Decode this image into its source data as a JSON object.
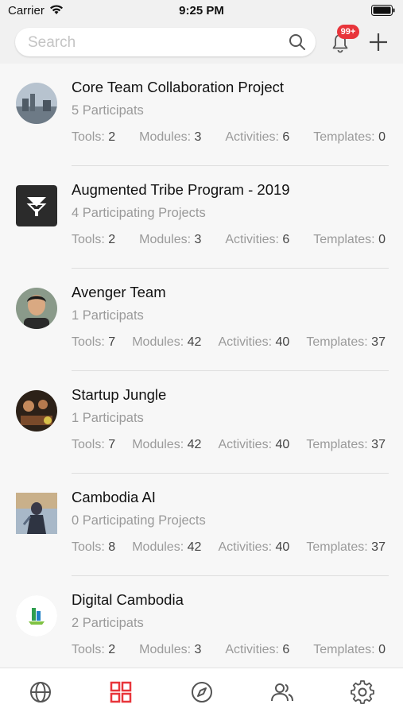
{
  "status_bar": {
    "carrier": "Carrier",
    "time": "9:25 PM"
  },
  "header": {
    "search_placeholder": "Search",
    "notification_badge": "99+"
  },
  "items": [
    {
      "title": "Core Team Collaboration Project",
      "subtitle": "5 Participats",
      "tools": "2",
      "modules": "3",
      "activities": "6",
      "templates": "0"
    },
    {
      "title": "Augmented Tribe Program - 2019",
      "subtitle": "4 Participating Projects",
      "tools": "2",
      "modules": "3",
      "activities": "6",
      "templates": "0"
    },
    {
      "title": "Avenger Team",
      "subtitle": "1 Participats",
      "tools": "7",
      "modules": "42",
      "activities": "40",
      "templates": "37"
    },
    {
      "title": "Startup Jungle",
      "subtitle": "1 Participats",
      "tools": "7",
      "modules": "42",
      "activities": "40",
      "templates": "37"
    },
    {
      "title": "Cambodia AI",
      "subtitle": "0 Participating Projects",
      "tools": "8",
      "modules": "42",
      "activities": "40",
      "templates": "37"
    },
    {
      "title": "Digital Cambodia",
      "subtitle": "2 Participats",
      "tools": "2",
      "modules": "3",
      "activities": "6",
      "templates": "0"
    }
  ],
  "labels": {
    "tools": "Tools:",
    "modules": "Modules:",
    "activities": "Activities:",
    "templates": "Templates:"
  },
  "tab_bar": {
    "tabs": [
      {
        "icon": "globe-icon",
        "active": false
      },
      {
        "icon": "grid-icon",
        "active": true
      },
      {
        "icon": "compass-icon",
        "active": false
      },
      {
        "icon": "users-icon",
        "active": false
      },
      {
        "icon": "gear-icon",
        "active": false
      }
    ]
  },
  "colors": {
    "accent": "#e8353b",
    "icon": "#555555"
  }
}
